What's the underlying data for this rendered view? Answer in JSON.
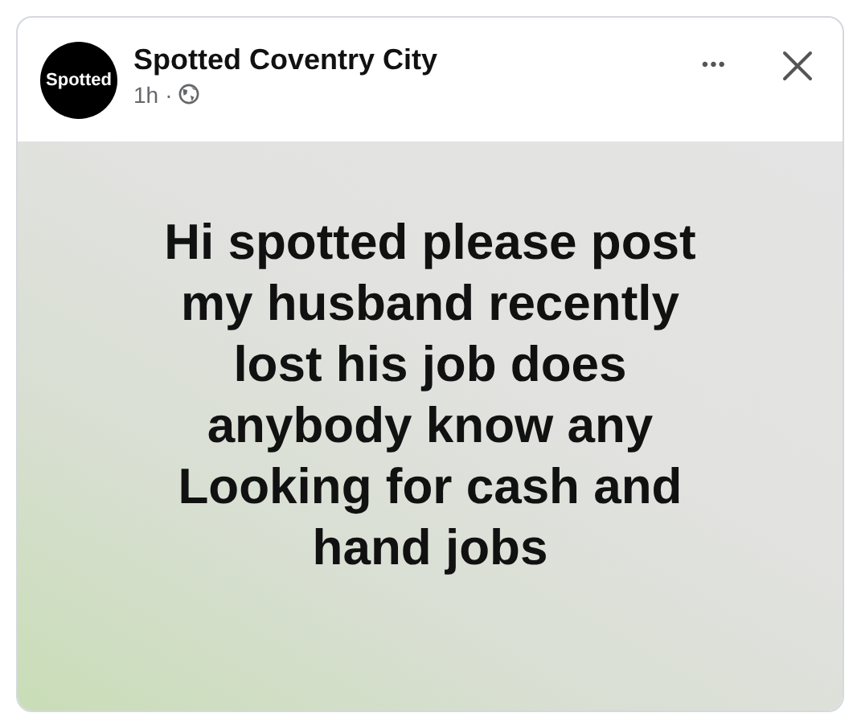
{
  "post": {
    "avatar_text": "Spotted",
    "page_name": "Spotted Coventry City",
    "time": "1h",
    "separator": "·",
    "more": "•••",
    "body_lines": [
      "Hi spotted please post",
      "my husband recently",
      "lost his job does",
      "anybody know any",
      "Looking for cash and",
      "hand jobs"
    ]
  }
}
